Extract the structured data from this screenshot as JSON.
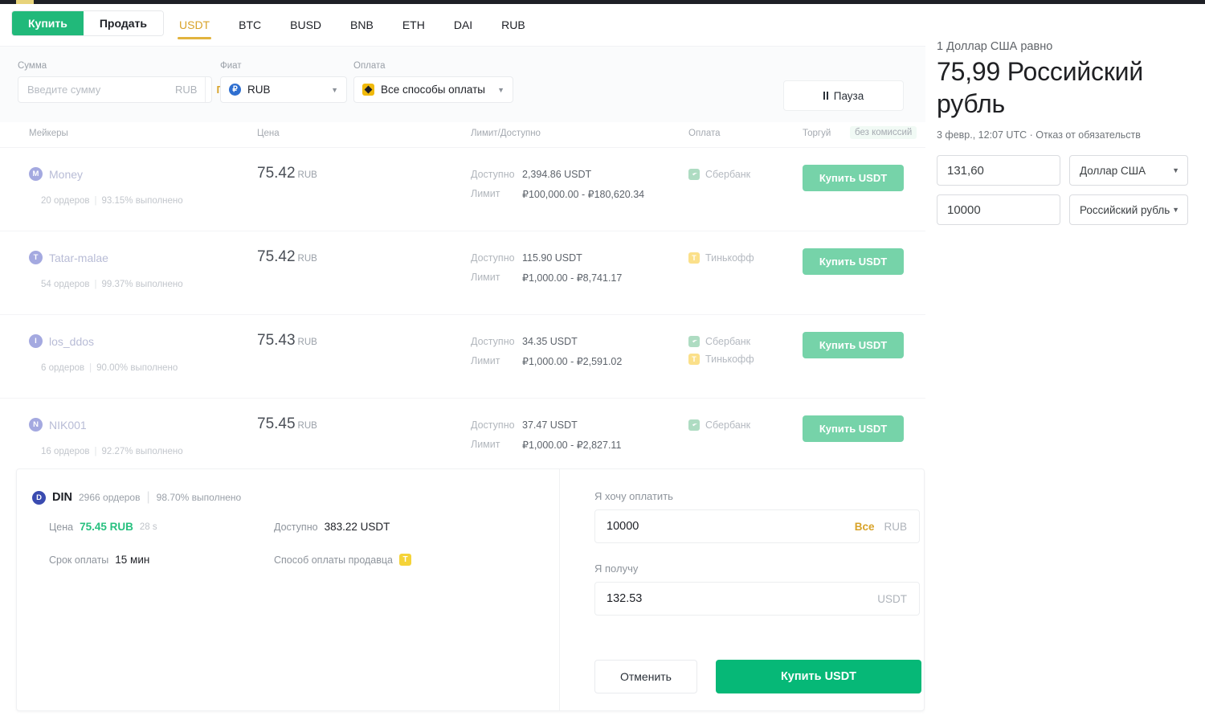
{
  "topbar": {
    "accent_color": "#e8d37a",
    "bar_color": "#1e2026"
  },
  "header": {
    "side_buttons": [
      {
        "label": "Купить",
        "active": true
      },
      {
        "label": "Продать",
        "active": false
      }
    ],
    "coins": [
      {
        "label": "USDT",
        "active": true
      },
      {
        "label": "BTC",
        "active": false
      },
      {
        "label": "BUSD",
        "active": false
      },
      {
        "label": "BNB",
        "active": false
      },
      {
        "label": "ETH",
        "active": false
      },
      {
        "label": "DAI",
        "active": false
      },
      {
        "label": "RUB",
        "active": false
      }
    ]
  },
  "filters": {
    "amount_label": "Сумма",
    "amount_placeholder": "Введите сумму",
    "amount_value": "",
    "amount_currency": "RUB",
    "search_label": "Поиск",
    "fiat_label": "Фиат",
    "fiat_value": "RUB",
    "fiat_icon": "ruble-coin-icon",
    "payment_label": "Оплата",
    "payment_value": "Все способы оплаты",
    "payment_icon": "binance-diamond-icon",
    "pause_label": "Пауза"
  },
  "table": {
    "columns": {
      "makers": "Мейкеры",
      "price": "Цена",
      "limit_available": "Лимит/Доступно",
      "payment": "Оплата",
      "trade": "Торгуй",
      "no_fee_badge": "без комиссий"
    },
    "labels": {
      "available": "Доступно",
      "limit": "Лимит",
      "orders_suffix": "ордеров",
      "completion_suffix": "выполнено"
    },
    "rows": [
      {
        "avatar_letter": "M",
        "name": "Money",
        "orders": "20 ордеров",
        "completion": "93.15% выполнено",
        "price": "75.42",
        "price_unit": "RUB",
        "available": "2,394.86 USDT",
        "limit": "₽100,000.00 - ₽180,620.34",
        "payments": [
          {
            "name": "Сбербанк",
            "icon": "sberbank-icon"
          }
        ],
        "action": "Купить USDT"
      },
      {
        "avatar_letter": "T",
        "name": "Tatar-malae",
        "orders": "54 ордеров",
        "completion": "99.37% выполнено",
        "price": "75.42",
        "price_unit": "RUB",
        "available": "115.90 USDT",
        "limit": "₽1,000.00 - ₽8,741.17",
        "payments": [
          {
            "name": "Тинькофф",
            "icon": "tinkoff-icon"
          }
        ],
        "action": "Купить USDT"
      },
      {
        "avatar_letter": "l",
        "name": "los_ddos",
        "orders": "6 ордеров",
        "completion": "90.00% выполнено",
        "price": "75.43",
        "price_unit": "RUB",
        "available": "34.35 USDT",
        "limit": "₽1,000.00 - ₽2,591.02",
        "payments": [
          {
            "name": "Сбербанк",
            "icon": "sberbank-icon"
          },
          {
            "name": "Тинькофф",
            "icon": "tinkoff-icon"
          }
        ],
        "action": "Купить USDT"
      },
      {
        "avatar_letter": "N",
        "name": "NIK001",
        "orders": "16 ордеров",
        "completion": "92.27% выполнено",
        "price": "75.45",
        "price_unit": "RUB",
        "available": "37.47 USDT",
        "limit": "₽1,000.00 - ₽2,827.11",
        "payments": [
          {
            "name": "Сбербанк",
            "icon": "sberbank-icon"
          }
        ],
        "action": "Купить USDT"
      }
    ]
  },
  "order_panel": {
    "avatar_letter": "D",
    "merchant": "DIN",
    "orders": "2966 ордеров",
    "completion": "98.70% выполнено",
    "price_key": "Цена",
    "price_value": "75.45 RUB",
    "price_timer": "28 s",
    "available_key": "Доступно",
    "available_value": "383.22 USDT",
    "payterm_key": "Срок оплаты",
    "payterm_value": "15 мин",
    "seller_method_key": "Способ оплаты продавца",
    "seller_method_icon": "tinkoff-icon",
    "pay_label": "Я хочу оплатить",
    "pay_value": "10000",
    "pay_all": "Все",
    "pay_currency": "RUB",
    "receive_label": "Я получу",
    "receive_value": "132.53",
    "receive_currency": "USDT",
    "cancel_label": "Отменить",
    "confirm_label": "Купить USDT"
  },
  "converter": {
    "headline": "1 Доллар США равно",
    "rate": "75,99 Российский рубль",
    "timestamp": "3 февр., 12:07 UTC · Отказ от обязательств",
    "from_value": "131,60",
    "from_currency": "Доллар США",
    "to_value": "10000",
    "to_currency": "Российский рубль"
  }
}
